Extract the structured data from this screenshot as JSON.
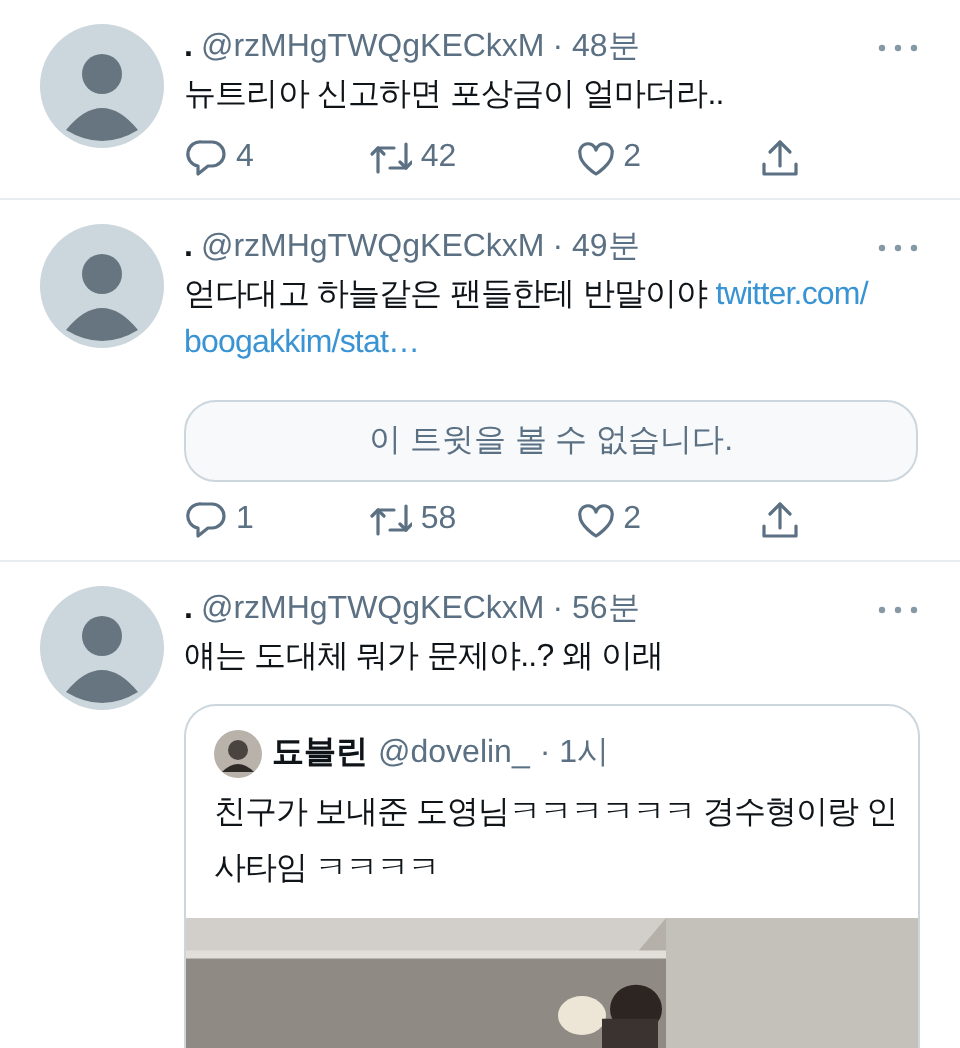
{
  "tweets": [
    {
      "display_name": ".",
      "handle": "@rzMHgTWQgKECkxM",
      "time": "· 48분",
      "text": "뉴트리아 신고하면 포상금이 얼마더라..",
      "replies": "4",
      "retweets": "42",
      "likes": "2"
    },
    {
      "display_name": ".",
      "handle": "@rzMHgTWQgKECkxM",
      "time": "· 49분",
      "text": "얻다대고 하늘같은 팬들한테 반말이야",
      "link_lines": [
        "twitter.com/",
        "boogakkim/stat…"
      ],
      "attachment": {
        "kind": "unavailable",
        "text": "이 트윗을 볼 수 없습니다."
      },
      "replies": "1",
      "retweets": "58",
      "likes": "2"
    },
    {
      "display_name": ".",
      "handle": "@rzMHgTWQgKECkxM",
      "time": "· 56분",
      "text": "얘는 도대체 뭐가 문제야..? 왜 이래",
      "attachment": {
        "kind": "quote",
        "display_name": "됴블린",
        "handle": "@dovelin_",
        "time": "· 1시",
        "text": "친구가 보내준 도영님ㅋㅋㅋㅋㅋㅋ 경수형이랑 인사타임 ㅋㅋㅋㅋ"
      }
    }
  ]
}
